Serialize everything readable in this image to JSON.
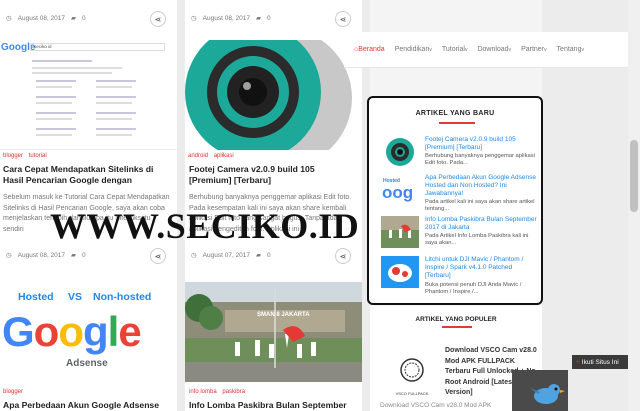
{
  "posts": {
    "top_left": {
      "date": "August 08, 2017",
      "comments": "0"
    },
    "top_mid": {
      "date": "August 08, 2017",
      "comments": "0"
    },
    "google_post": {
      "tags": [
        "blogger",
        "tutorial"
      ],
      "title": "Cara Cepat Mendapatkan Sitelinks di Hasil Pencarian Google dengan",
      "excerpt": "Sebelum masuk ke Tutorial Cara Cepat Mendapatkan Sitelinks di Hasil Pencarian Google, saya akan coba menjelaskan terlebih dahulu apa itu Sitelinks itu sendiri",
      "date": "August 08, 2017",
      "comments": "0",
      "search_query": "seciko id",
      "google_logo": "Google"
    },
    "camera_post": {
      "tags": [
        "android",
        "aplikasi"
      ],
      "title": "Footej Camera v2.0.9 build 105 [Premium] [Terbaru]",
      "excerpt": "Berhubung banyaknya penggemar aplikasi Edit foto. Pada kesempatan kali ini saya akan share kembali aplikasi Edit foto yang sangat bagus. Tanpa ada aplikasi pengeditan foto. Aplikasi ini",
      "date": "August 07, 2017",
      "comments": "0"
    },
    "adsense_post": {
      "tags": [
        "blogger"
      ],
      "title": "Apa Perbedaan Akun Google Adsense",
      "image_hosted": "Hosted",
      "image_vs": "VS",
      "image_nonhosted": "Non-hosted",
      "image_google": "Google",
      "image_adsense": "Adsense"
    },
    "paskibra_post": {
      "tags": [
        "info lomba",
        "paskibra"
      ],
      "title": "Info Lomba Paskibra Bulan September",
      "image_banner": "SMAN 8 JAKARTA"
    }
  },
  "watermark": "WWW.SECIKO.ID",
  "navbar": {
    "items": [
      {
        "label": "Beranda",
        "icon": "home-icon",
        "active": true
      },
      {
        "label": "Pendidikan",
        "caret": "v"
      },
      {
        "label": "Tutorial",
        "caret": "v"
      },
      {
        "label": "Download",
        "caret": "v"
      },
      {
        "label": "Partner",
        "caret": "v"
      },
      {
        "label": "Tentang",
        "caret": "v"
      }
    ]
  },
  "widget_recent": {
    "title": "ARTIKEL YANG BARU",
    "items": [
      {
        "title": "Footej Camera v2.0.9 build 105 [Premium] [Terbaru]",
        "text": "Berhubung banyaknya penggemar aplikasi Edit foto. Pada..."
      },
      {
        "title": "Apa Perbedaan Akun Google Adsense Hosted dan Non Hosted? Ini Jawabannya!",
        "text": "Pada artikel kali ini saya akan share artikel tentang..."
      },
      {
        "title": "Info Lomba Paskibra Bulan September 2017 di Jakarta",
        "text": "Pada Artikel Info Lomba Paskibra kali ini saya akan..."
      },
      {
        "title": "Litchi untuk DJI Mavic / Phantom / Inspire / Spark v4.1.0 Patched [Terbaru]",
        "text": "Buka potensi penuh DJI Anda Mavic / Phantom / Inspire /..."
      }
    ]
  },
  "widget_popular": {
    "title": "ARTIKEL YANG POPULER",
    "item_title": "Download VSCO Cam v28.0 Mod APK FULLPACK Terbaru Full Unlocked + No Root Android [Latest Version]",
    "caption": "Download VSCO Cam v28.0 Mod APK",
    "logo_text": "VSCO FULLPACK"
  },
  "follow_label": "Ikuti Situs Ini",
  "colors": {
    "accent": "#e53935",
    "link": "#1e88e5"
  }
}
